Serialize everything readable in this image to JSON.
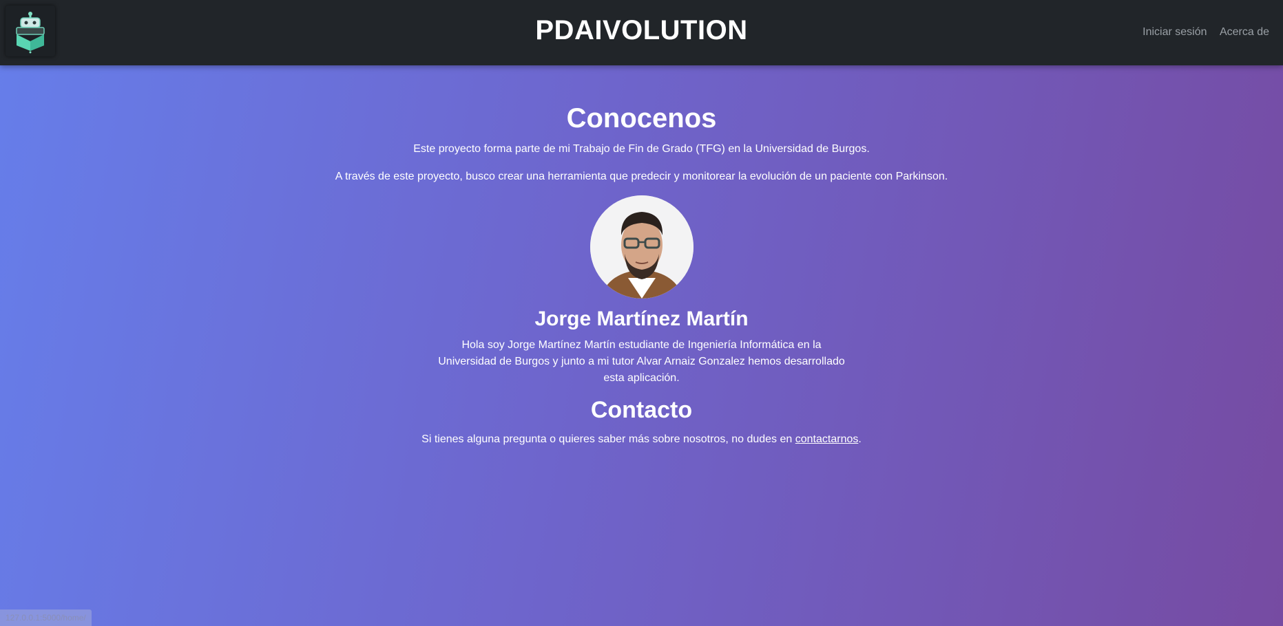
{
  "navbar": {
    "brand": "PDAIVOLUTION",
    "links": [
      "Iniciar sesión",
      "Acerca de"
    ]
  },
  "about": {
    "title": "Conocenos",
    "paragraph1": "Este proyecto forma parte de mi Trabajo de Fin de Grado (TFG) en la Universidad de Burgos.",
    "paragraph2": "A través de este proyecto, busco crear una herramienta que predecir y monitorear la evolución de un paciente con Parkinson."
  },
  "person": {
    "name": "Jorge Martínez Martín",
    "bio": "Hola soy Jorge Martínez Martín estudiante de Ingeniería Informática en la Universidad de Burgos y junto a mi tutor Alvar Arnaiz Gonzalez hemos desarrollado esta aplicación."
  },
  "contact": {
    "title": "Contacto",
    "text_before": "Si tienes alguna pregunta o quieres saber más sobre nosotros, no dudes en ",
    "link_text": "contactarnos",
    "text_after": "."
  },
  "status_bar": {
    "url": "127.0.0.1:5000/home/"
  },
  "colors": {
    "navbar_bg": "#212529",
    "gradient_start": "#667eea",
    "gradient_end": "#764ba2"
  }
}
